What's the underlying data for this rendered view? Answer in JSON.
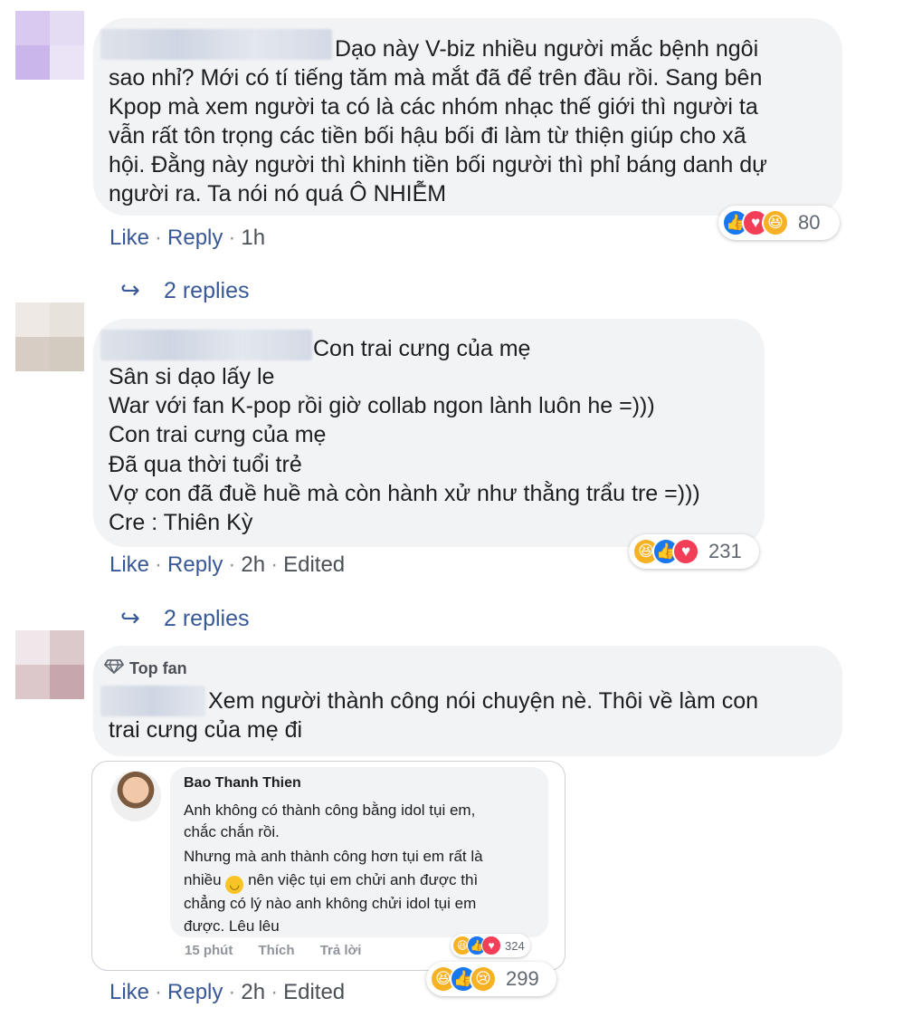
{
  "comments": [
    {
      "text_lines": [
        "Dạo này V-biz nhiều người mắc bệnh ngôi",
        "sao nhỉ? Mới có tí tiếng tăm mà mắt đã để trên đầu rồi. Sang bên",
        "Kpop mà xem người ta có là các nhóm nhạc thế giới thì người ta",
        "vẫn rất tôn trọng các tiền bối hậu bối đi làm từ thiện giúp cho xã",
        "hội. Đằng này người thì khinh tiền bối người thì phỉ báng danh dự",
        "người ra. Ta nói nó quá Ô NHIỄM"
      ],
      "like": "Like",
      "reply": "Reply",
      "time": "1h",
      "reaction_count": "80",
      "replies": "2 replies"
    },
    {
      "text_lines": [
        "Con trai cưng của mẹ",
        "Sân si dạo lấy le",
        "War với fan K-pop rồi giờ collab ngon lành luôn he =)))",
        "Con trai cưng của mẹ",
        "Đã qua thời tuổi trẻ",
        "Vợ con đã đuề huề mà còn hành xử như thằng trẩu tre =)))",
        "Cre : Thiên Kỳ"
      ],
      "like": "Like",
      "reply": "Reply",
      "time": "2h",
      "edited": "Edited",
      "reaction_count": "231",
      "replies": "2 replies"
    },
    {
      "badge": "Top fan",
      "text_lines": [
        "Xem người thành công nói chuyện nè. Thôi về làm con",
        "trai cưng của mẹ đi"
      ],
      "like": "Like",
      "reply": "Reply",
      "time": "2h",
      "edited": "Edited",
      "reaction_count": "299"
    }
  ],
  "embedded": {
    "name": "Bao Thanh Thien",
    "lines": [
      "Anh không có thành công bằng idol tụi em,",
      "chắc chắn rồi.",
      "Nhưng mà anh thành công hơn tụi em rất là",
      "nhiều",
      "nên việc tụi em chửi anh được thì",
      "chẳng có lý nào anh không chửi idol tụi em",
      "được. Lêu lêu"
    ],
    "time": "15 phút",
    "like": "Thích",
    "reply": "Trả lời",
    "reaction_count": "324"
  },
  "colors": {
    "link": "#385898",
    "bubble": "#f2f3f5",
    "like": "#1877f2",
    "love": "#f33e58",
    "haha": "#f7b125"
  }
}
